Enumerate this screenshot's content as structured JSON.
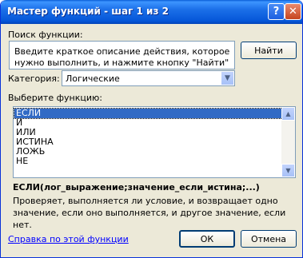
{
  "window": {
    "title": "Мастер функций - шаг 1 из 2",
    "help_glyph": "?",
    "close_glyph": "✕"
  },
  "search": {
    "label": "Поиск функции:",
    "text": "Введите краткое описание действия, которое нужно выполнить, и нажмите кнопку \"Найти\"",
    "button_label": "Найти"
  },
  "category": {
    "label": "Категория:",
    "selected": "Логические",
    "arrow_glyph": "▼"
  },
  "functions": {
    "label": "Выберите функцию:",
    "items": [
      "ЕСЛИ",
      "И",
      "ИЛИ",
      "ИСТИНА",
      "ЛОЖЬ",
      "НЕ"
    ],
    "selected_index": 0,
    "scroll_up_glyph": "▲",
    "scroll_down_glyph": "▼"
  },
  "details": {
    "signature": "ЕСЛИ(лог_выражение;значение_если_истина;...)",
    "description": "Проверяет, выполняется ли условие, и возвращает одно значение, если оно выполняется, и другое значение, если нет."
  },
  "footer": {
    "help_link": "Справка по этой функции",
    "ok_label": "ОК",
    "cancel_label": "Отмена"
  }
}
